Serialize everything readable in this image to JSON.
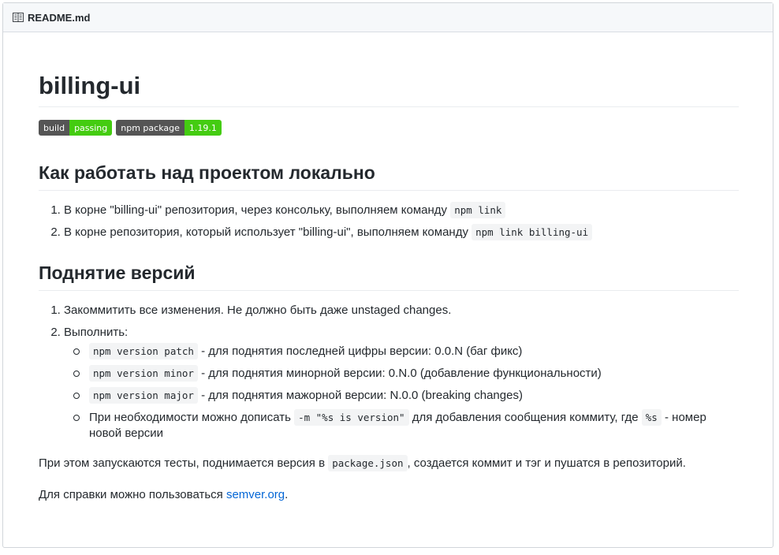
{
  "header": {
    "filename": "README.md"
  },
  "title": "billing-ui",
  "badges": [
    {
      "label": "build",
      "value": "passing"
    },
    {
      "label": "npm package",
      "value": "1.19.1"
    }
  ],
  "section1": {
    "heading": "Как работать над проектом локально",
    "items": [
      {
        "text": "В корне \"billing-ui\" репозитория, через консольку, выполняем команду ",
        "code": "npm link"
      },
      {
        "text": "В корне репозитория, который использует \"billing-ui\", выполняем команду ",
        "code": "npm link billing-ui"
      }
    ]
  },
  "section2": {
    "heading": "Поднятие версий",
    "item1": "Закоммитить все изменения. Не должно быть даже unstaged changes.",
    "item2": "Выполнить:",
    "subitems": [
      {
        "code": "npm version patch",
        "text": " - для поднятия последней цифры версии: 0.0.N (баг фикс)"
      },
      {
        "code": "npm version minor",
        "text": " - для поднятия минорной версии: 0.N.0 (добавление функциональности)"
      },
      {
        "code": "npm version major",
        "text": " - для поднятия мажорной версии: N.0.0 (breaking changes)"
      }
    ],
    "sub4": {
      "pre": "При необходимости можно дописать ",
      "code1": "-m \"%s is version\"",
      "mid": " для добавления сообщения коммиту, где ",
      "code2": "%s",
      "post": " - номер новой версии"
    }
  },
  "para1": {
    "pre": "При этом запускаются тесты, поднимается версия в ",
    "code": "package.json",
    "post": ", создается коммит и тэг и пушатся в репозиторий."
  },
  "para2": {
    "pre": "Для справки можно пользоваться ",
    "link": "semver.org",
    "post": "."
  }
}
